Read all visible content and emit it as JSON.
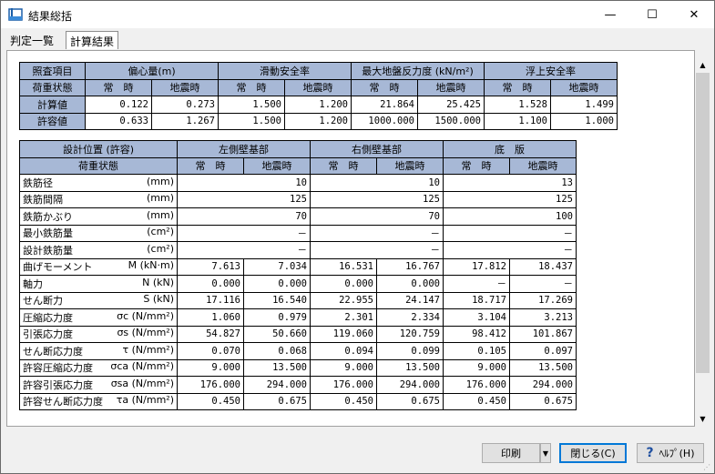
{
  "window": {
    "title": "結果総括",
    "minimize_glyph": "—",
    "maximize_glyph": "☐",
    "close_glyph": "✕"
  },
  "tabs": [
    {
      "label": "判定一覧"
    },
    {
      "label": "計算結果"
    }
  ],
  "table1": {
    "headers": [
      "照査項目",
      "偏心量(m)",
      "滑動安全率",
      "最大地盤反力度 (kN/m²)",
      "浮上安全率"
    ],
    "subheaders": [
      "荷重状態",
      "常　時",
      "地震時",
      "常　時",
      "地震時",
      "常　時",
      "地震時",
      "常　時",
      "地震時"
    ],
    "rows": [
      {
        "label": "計算値",
        "values": [
          "0.122",
          "0.273",
          "1.500",
          "1.200",
          "21.864",
          "25.425",
          "1.528",
          "1.499"
        ]
      },
      {
        "label": "許容値",
        "values": [
          "0.633",
          "1.267",
          "1.500",
          "1.200",
          "1000.000",
          "1500.000",
          "1.100",
          "1.000"
        ]
      }
    ]
  },
  "table2": {
    "headers": [
      "設計位置 (許容)",
      "左側壁基部",
      "右側壁基部",
      "底　版"
    ],
    "subheaders": [
      "荷重状態",
      "常　時",
      "地震時",
      "常　時",
      "地震時",
      "常　時",
      "地震時"
    ],
    "merged_rows": [
      {
        "label": "鉄筋径",
        "unit": "(mm)",
        "values": [
          "10",
          "10",
          "13"
        ]
      },
      {
        "label": "鉄筋間隔",
        "unit": "(mm)",
        "values": [
          "125",
          "125",
          "125"
        ]
      },
      {
        "label": "鉄筋かぶり",
        "unit": "(mm)",
        "values": [
          "70",
          "70",
          "100"
        ]
      },
      {
        "label": "最小鉄筋量",
        "unit": "(cm²)",
        "values": [
          "－",
          "－",
          "－"
        ]
      },
      {
        "label": "設計鉄筋量",
        "unit": "(cm²)",
        "values": [
          "－",
          "－",
          "－"
        ]
      }
    ],
    "rows": [
      {
        "label": "曲げモーメント",
        "sym": "M",
        "unit": "(kN·m)",
        "values": [
          "7.613",
          "7.034",
          "16.531",
          "16.767",
          "17.812",
          "18.437"
        ]
      },
      {
        "label": "軸力",
        "sym": "N",
        "unit": "(kN)",
        "values": [
          "0.000",
          "0.000",
          "0.000",
          "0.000",
          "－",
          "－"
        ]
      },
      {
        "label": "せん断力",
        "sym": "S",
        "unit": "(kN)",
        "values": [
          "17.116",
          "16.540",
          "22.955",
          "24.147",
          "18.717",
          "17.269"
        ]
      },
      {
        "label": "圧縮応力度",
        "sym": "σc",
        "unit": "(N/mm²)",
        "values": [
          "1.060",
          "0.979",
          "2.301",
          "2.334",
          "3.104",
          "3.213"
        ]
      },
      {
        "label": "引張応力度",
        "sym": "σs",
        "unit": "(N/mm²)",
        "values": [
          "54.827",
          "50.660",
          "119.060",
          "120.759",
          "98.412",
          "101.867"
        ]
      },
      {
        "label": "せん断応力度",
        "sym": "τ",
        "unit": "(N/mm²)",
        "values": [
          "0.070",
          "0.068",
          "0.094",
          "0.099",
          "0.105",
          "0.097"
        ]
      },
      {
        "label": "許容圧縮応力度",
        "sym": "σca",
        "unit": "(N/mm²)",
        "values": [
          "9.000",
          "13.500",
          "9.000",
          "13.500",
          "9.000",
          "13.500"
        ]
      },
      {
        "label": "許容引張応力度",
        "sym": "σsa",
        "unit": "(N/mm²)",
        "values": [
          "176.000",
          "294.000",
          "176.000",
          "294.000",
          "176.000",
          "294.000"
        ]
      },
      {
        "label": "許容せん断応力度",
        "sym": "τa",
        "unit": "(N/mm²)",
        "values": [
          "0.450",
          "0.675",
          "0.450",
          "0.675",
          "0.450",
          "0.675"
        ]
      }
    ]
  },
  "footer": {
    "print_label": "印刷",
    "print_arrow": "▼",
    "close_label": "閉じる(C)",
    "help_label": "ﾍﾙﾌﾟ(H)",
    "help_glyph": "?"
  },
  "scroll": {
    "up": "▲",
    "down": "▼"
  },
  "colors": {
    "header_bg": "#a7b8d6",
    "accent": "#0078d7"
  }
}
